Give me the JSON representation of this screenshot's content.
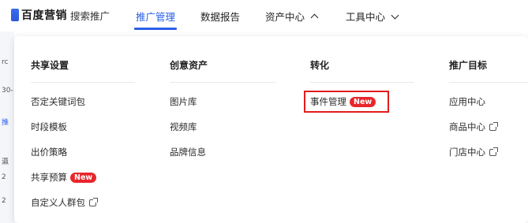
{
  "header": {
    "brand_name": "百度营销",
    "brand_sub": "搜索推广",
    "nav": [
      {
        "label": "推广管理",
        "active": true
      },
      {
        "label": "数据报告",
        "active": false
      },
      {
        "label": "资产中心",
        "active": false,
        "chevron": "up"
      },
      {
        "label": "工具中心",
        "active": false,
        "chevron": "down"
      }
    ]
  },
  "left_strip": {
    "fragments": [
      "rc",
      "30-",
      "推",
      "瀛",
      "2",
      "2"
    ]
  },
  "menu": {
    "columns": [
      {
        "title": "共享设置",
        "items": [
          {
            "label": "否定关键词包"
          },
          {
            "label": "时段模板"
          },
          {
            "label": "出价策略"
          },
          {
            "label": "共享预算",
            "badge": "New"
          },
          {
            "label": "自定义人群包",
            "external": true
          }
        ]
      },
      {
        "title": "创意资产",
        "items": [
          {
            "label": "图片库"
          },
          {
            "label": "视频库"
          },
          {
            "label": "品牌信息"
          }
        ]
      },
      {
        "title": "转化",
        "items": [
          {
            "label": "事件管理",
            "badge": "New",
            "highlighted": true
          }
        ]
      },
      {
        "title": "推广目标",
        "items": [
          {
            "label": "应用中心"
          },
          {
            "label": "商品中心",
            "external": true
          },
          {
            "label": "门店中心",
            "external": true
          }
        ]
      }
    ]
  },
  "colors": {
    "accent": "#2a5fe8",
    "badge": "#e8262b",
    "highlight": "#e21b1b"
  }
}
